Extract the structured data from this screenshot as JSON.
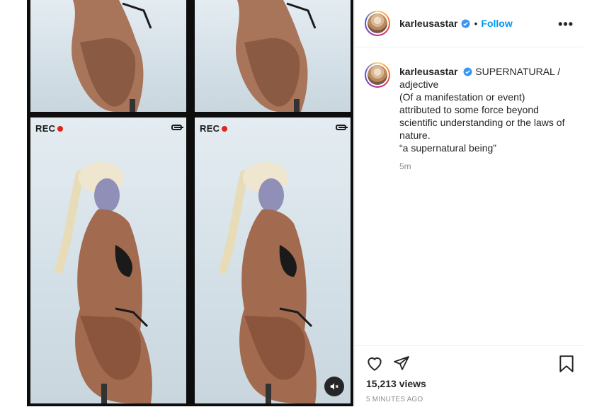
{
  "media": {
    "rec_label": "REC",
    "rec_color": "#e0261b",
    "panels": [
      "top-left",
      "top-right",
      "bottom-left",
      "bottom-right"
    ],
    "mute_icon": "speaker-muted-icon"
  },
  "post": {
    "username": "karleusastar",
    "verified_icon": "verified-badge-icon",
    "separator": "•",
    "follow_label": "Follow",
    "more_icon": "more-options-icon",
    "caption_lines": [
      "SUPERNATURAL /",
      "adjective",
      "(Of a manifestation or event)",
      "attributed to some force beyond",
      "scientific understanding or the laws of",
      "nature.",
      "“a supernatural being”"
    ],
    "caption_time": "5m",
    "views": "15,213 views",
    "time_ago": "5 MINUTES AGO"
  },
  "colors": {
    "follow": "#0095f6",
    "verified": "#3897f0",
    "muted_text": "#8e8e8e"
  }
}
